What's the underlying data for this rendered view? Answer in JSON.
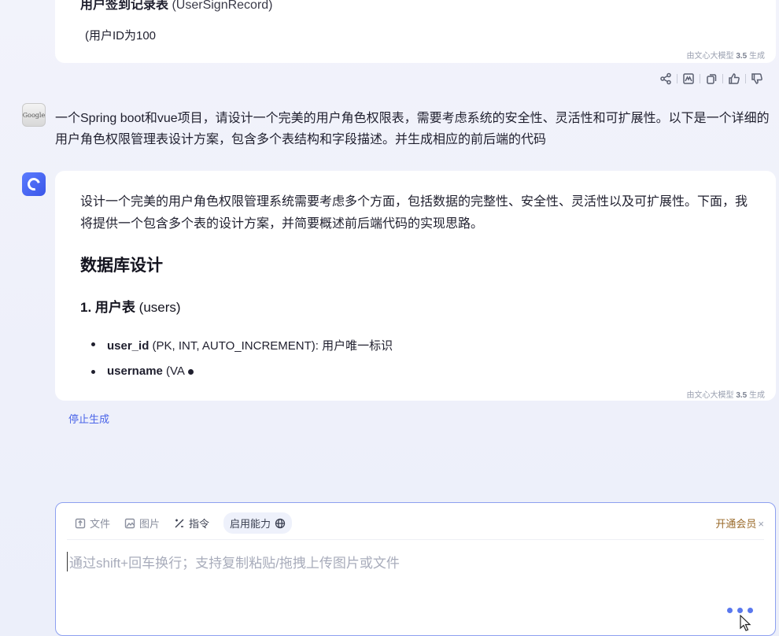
{
  "prev_answer": {
    "heading": "用户签到记录表",
    "heading_en": "(UserSignRecord)",
    "line": "(用户ID为100",
    "gen_note_prefix": "由文心大模型",
    "gen_note_version": "3.5",
    "gen_note_suffix": "生成"
  },
  "actions": {
    "icons": [
      "share-icon",
      "image-icon",
      "copy-icon",
      "thumbs-up-icon",
      "thumbs-down-icon"
    ]
  },
  "user_message": {
    "avatar_text": "Google",
    "text": "一个Spring boot和vue项目，请设计一个完美的用户角色权限表，需要考虑系统的安全性、灵活性和可扩展性。以下是一个详细的用户角色权限管理表设计方案，包含多个表结构和字段描述。并生成相应的前后端的代码"
  },
  "answer": {
    "intro": "设计一个完美的用户角色权限管理系统需要考虑多个方面，包括数据的完整性、安全性、灵活性以及可扩展性。下面，我将提供一个包含多个表的设计方案，并简要概述前后端代码的实现思路。",
    "h2": "数据库设计",
    "h3_num": "1.",
    "h3": "用户表",
    "h3_en": "(users)",
    "bullets": [
      {
        "key": "user_id",
        "text": " (PK, INT, AUTO_INCREMENT): 用户唯一标识"
      },
      {
        "key": "username",
        "text": " (VA"
      }
    ],
    "gen_note_prefix": "由文心大模型",
    "gen_note_version": "3.5",
    "gen_note_suffix": "生成"
  },
  "stop_label": "停止生成",
  "composer": {
    "file_label": "文件",
    "image_label": "图片",
    "command_label": "指令",
    "ability_label": "启用能力",
    "vip_label": "开通会员",
    "vip_close": "×",
    "placeholder": "通过shift+回车换行；支持复制粘贴/拖拽上传图片或文件"
  },
  "colors": {
    "accent": "#4a64e8",
    "vip": "#9a6a2a",
    "bot_avatar": "#3a56e8"
  }
}
